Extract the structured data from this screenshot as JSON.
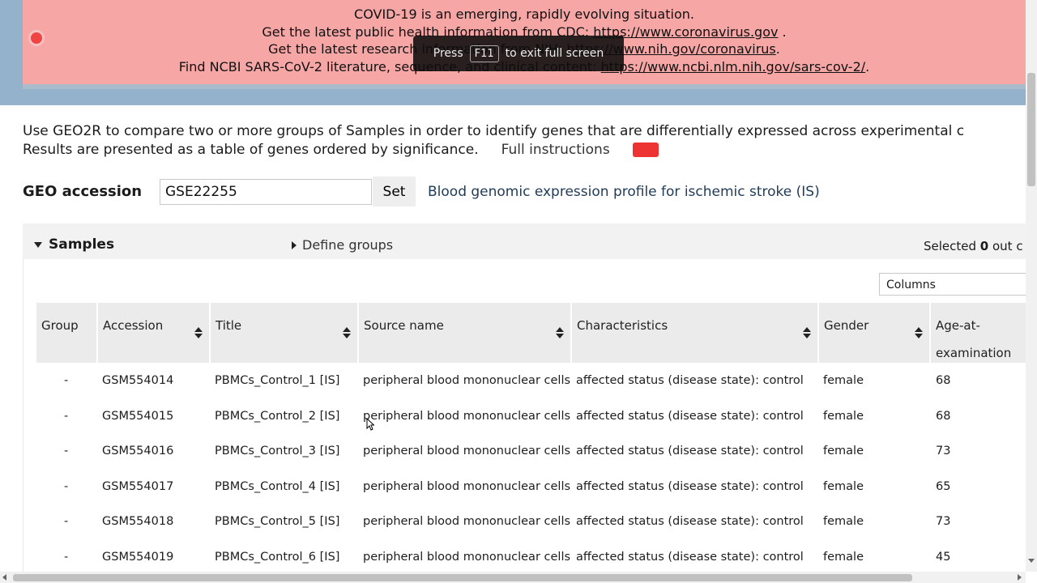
{
  "banner": {
    "line1": "COVID-19 is an emerging, rapidly evolving situation.",
    "line2_prefix": "Get the latest public health information from CDC: ",
    "line2_link": "https://www.coronavirus.gov",
    "line2_suffix": " .",
    "line3_prefix": "Get the latest research information from NIH: ",
    "line3_link": "https://www.nih.gov/coronavirus",
    "line3_suffix": ".",
    "line4_prefix": "Find NCBI SARS-CoV-2 literature, sequence, and clinical content: ",
    "line4_link": "https://www.ncbi.nlm.nih.gov/sars-cov-2/",
    "line4_suffix": "."
  },
  "fullscreen_toast": {
    "press": "Press",
    "key": "F11",
    "suffix": "to exit full screen"
  },
  "intro": {
    "line1": "Use GEO2R to compare two or more groups of Samples in order to identify genes that are differentially expressed across experimental c",
    "line2": "Results are presented as a table of genes ordered by significance.",
    "full_instructions": "Full instructions"
  },
  "accession": {
    "label": "GEO accession",
    "value": "GSE22255",
    "set_label": "Set",
    "title": "Blood genomic expression profile for ischemic stroke (IS)"
  },
  "samples": {
    "title": "Samples",
    "define_groups": "Define groups",
    "selected_prefix": "Selected ",
    "selected_count": "0",
    "selected_suffix": " out c",
    "columns_select": "Columns"
  },
  "table": {
    "headers": {
      "group": "Group",
      "accession": "Accession",
      "title": "Title",
      "source": "Source name",
      "characteristics": "Characteristics",
      "gender": "Gender",
      "age_line1": "Age-at-",
      "age_line2": "examination"
    },
    "rows": [
      {
        "group": "-",
        "accession": "GSM554014",
        "title": "PBMCs_Control_1 [IS]",
        "source": "peripheral blood mononuclear cells",
        "characteristics": "affected status (disease state): control",
        "gender": "female",
        "age": "68"
      },
      {
        "group": "-",
        "accession": "GSM554015",
        "title": "PBMCs_Control_2 [IS]",
        "source": "peripheral blood mononuclear cells",
        "characteristics": "affected status (disease state): control",
        "gender": "female",
        "age": "68"
      },
      {
        "group": "-",
        "accession": "GSM554016",
        "title": "PBMCs_Control_3 [IS]",
        "source": "peripheral blood mononuclear cells",
        "characteristics": "affected status (disease state): control",
        "gender": "female",
        "age": "73"
      },
      {
        "group": "-",
        "accession": "GSM554017",
        "title": "PBMCs_Control_4 [IS]",
        "source": "peripheral blood mononuclear cells",
        "characteristics": "affected status (disease state): control",
        "gender": "female",
        "age": "65"
      },
      {
        "group": "-",
        "accession": "GSM554018",
        "title": "PBMCs_Control_5 [IS]",
        "source": "peripheral blood mononuclear cells",
        "characteristics": "affected status (disease state): control",
        "gender": "female",
        "age": "73"
      },
      {
        "group": "-",
        "accession": "GSM554019",
        "title": "PBMCs_Control_6 [IS]",
        "source": "peripheral blood mononuclear cells",
        "characteristics": "affected status (disease state): control",
        "gender": "female",
        "age": "45"
      }
    ]
  }
}
